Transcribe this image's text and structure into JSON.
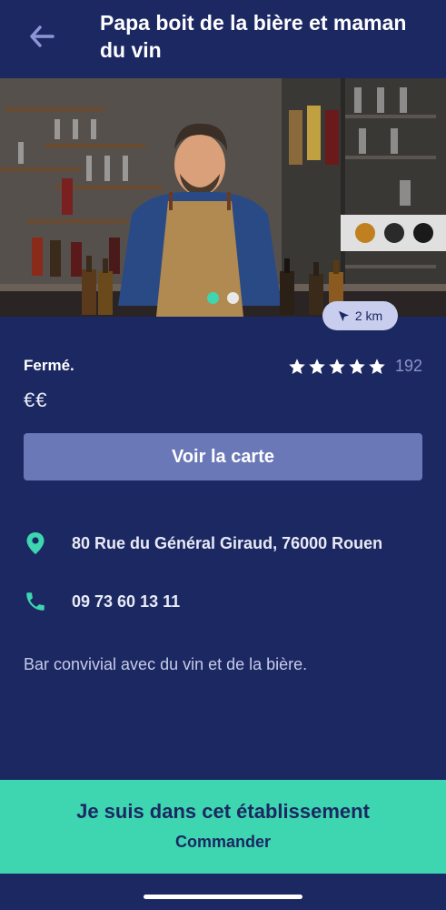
{
  "header": {
    "back_icon": "arrow-left-icon",
    "title": "Papa boit de la bière et maman du vin"
  },
  "photo": {
    "description_icon": "bar-photo",
    "carousel_total": 2,
    "carousel_active": 1,
    "distance": "2 km",
    "distance_icon": "navigation-arrow-icon"
  },
  "details": {
    "status": "Fermé.",
    "price": "€€",
    "rating_stars": 5,
    "review_count": "192",
    "menu_button": "Voir la carte"
  },
  "contact": {
    "address_icon": "map-pin-icon",
    "address": "80 Rue du Général Giraud, 76000 Rouen",
    "phone_icon": "phone-icon",
    "phone": "09 73 60 13 11"
  },
  "description": "Bar convivial avec du vin et de la bière.",
  "cta": {
    "title": "Je suis dans cet établissement",
    "subtitle": "Commander"
  },
  "colors": {
    "background": "#1c2862",
    "accent": "#3dd6b0",
    "button": "#6b78b8"
  }
}
